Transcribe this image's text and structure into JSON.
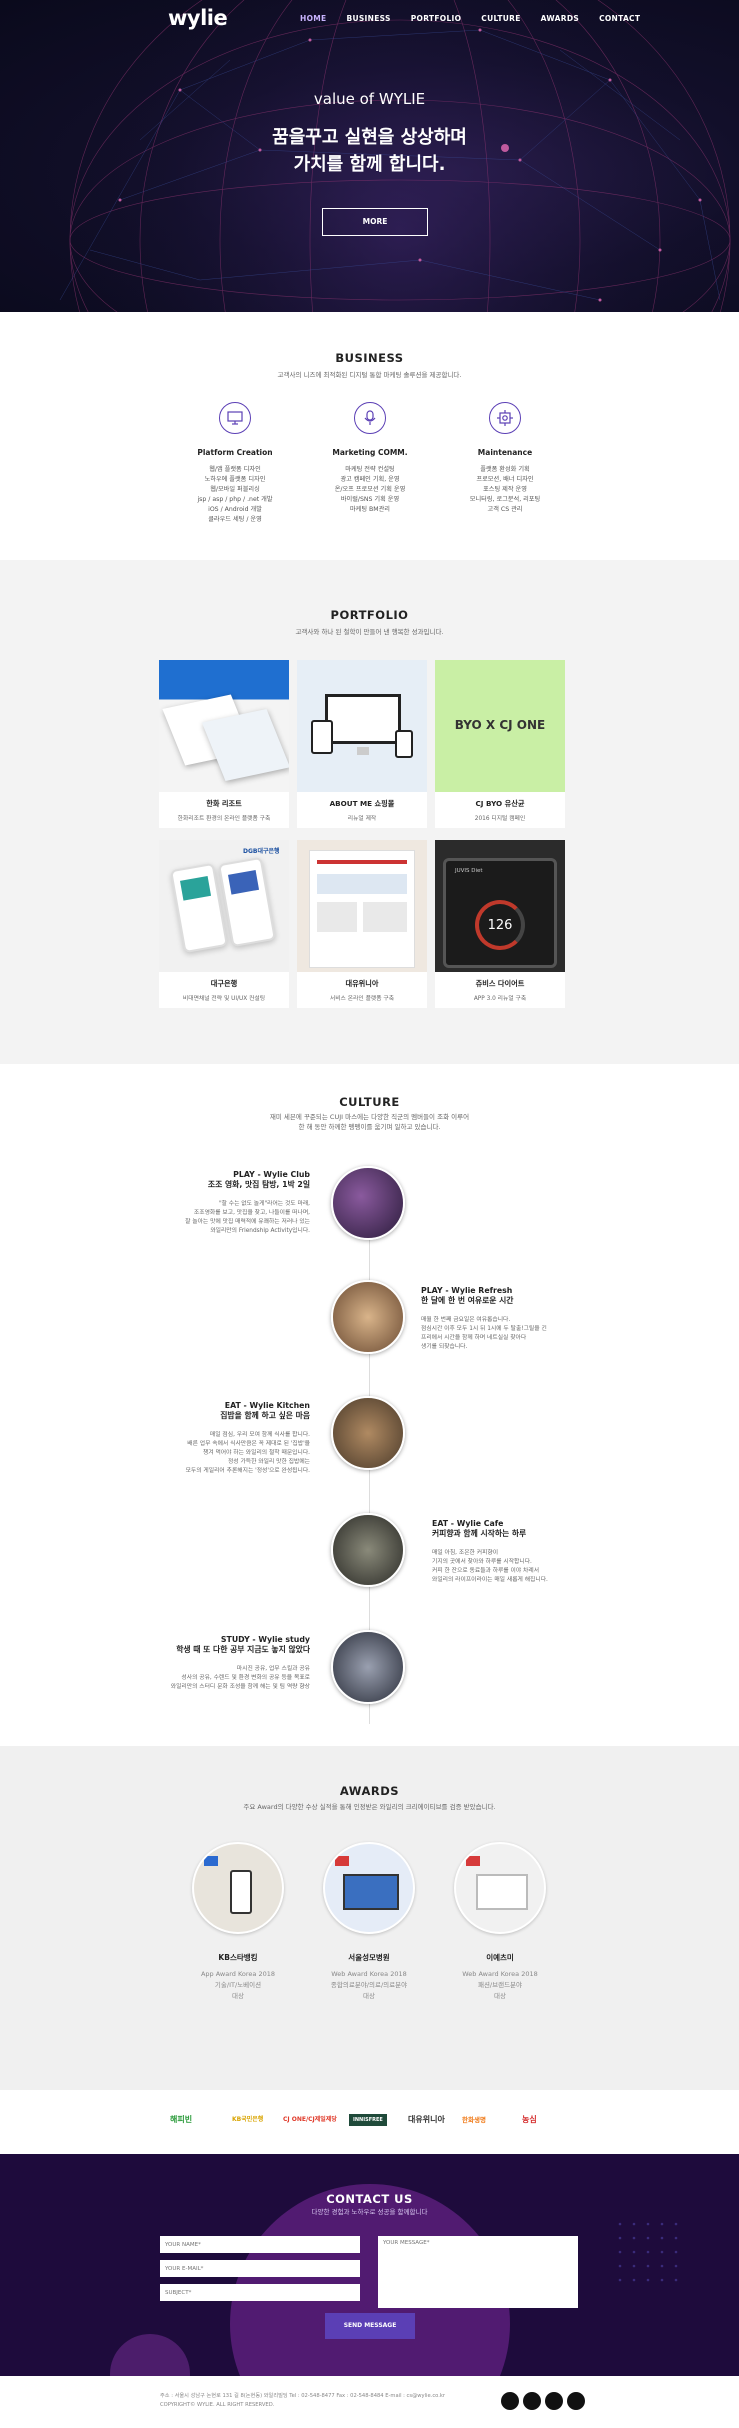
{
  "nav": {
    "logo": "wylie",
    "items": [
      "HOME",
      "BUSINESS",
      "PORTFOLIO",
      "CULTURE",
      "AWARDS",
      "CONTACT"
    ],
    "active": "HOME"
  },
  "hero": {
    "subtitle": "value of WYLIE",
    "title_line1": "꿈을꾸고 실현을 상상하며",
    "title_line2": "가치를 함께 합니다.",
    "button": "MORE"
  },
  "business": {
    "title": "BUSINESS",
    "desc": "고객사의 니즈에 최적화된 디지털 통합 마케팅 솔루션을 제공합니다.",
    "services": [
      {
        "icon": "monitor-icon",
        "title": "Platform Creation",
        "lines": [
          "웹/앱 플랫폼 디자인",
          "노하우에 플랫폼 디자인",
          "웹/모바일 퍼블리싱",
          "jsp / asp / php / .net 개발",
          "iOS / Android 개발",
          "클라우드 세팅 / 운영"
        ]
      },
      {
        "icon": "microphone-icon",
        "title": "Marketing COMM.",
        "lines": [
          "마케팅 전략 컨설팅",
          "광고 캠페인 기획, 운영",
          "온/오프 프로모션 기획 운영",
          "바이럴/SNS 기획 운영",
          "마케팅 BM관리"
        ]
      },
      {
        "icon": "maintenance-icon",
        "title": "Maintenance",
        "lines": [
          "플랫폼 환성화 기획",
          "프로모션, 배너 디자인",
          "포스팅 제작 운영",
          "모니터링, 로그분석, 리포팅",
          "고객 CS 관리"
        ]
      }
    ]
  },
  "portfolio": {
    "title": "PORTFOLIO",
    "desc": "고객사와 하나 된 철학이 만들어 낸 행복한 성과입니다.",
    "items": [
      {
        "title": "한화 리조트",
        "sub": "한화리조트 환경의 온라인 플랫폼 구축"
      },
      {
        "title": "ABOUT ME 쇼핑몰",
        "sub": "리뉴얼 제작"
      },
      {
        "title": "CJ BYO 유산균",
        "sub": "2016 디지털 캠페인",
        "logo": "BYO X CJ ONE"
      },
      {
        "title": "대구은행",
        "sub": "비대면채널 전략 및 UI/UX 컨설팅",
        "badge": "DGB대구은행"
      },
      {
        "title": "대유위니아",
        "sub": "서비스 온라인 플랫폼 구축"
      },
      {
        "title": "쥬비스 다이어트",
        "sub": "APP 3.0 리뉴얼 구축",
        "app": "JUVIS Diet",
        "metric": "126"
      }
    ]
  },
  "culture": {
    "title": "CULTURE",
    "desc_line1": "재미 세븐에 꾸준되는 CUJI 마스에는 다양한 직군의 멤버들이 조화 이루어",
    "desc_line2": "한 해 동안 하께한 펭펭이를 움기며 일하고 있습니다.",
    "items": [
      {
        "t1": "PLAY - Wylie Club",
        "t2": "조조 영화, 맛집 탐방, 1박 2일",
        "d": [
          "\"할 수는 없도 놀게\"라어는 것도 마래,",
          "조조영화를 보고, 맛집을 찾고, 나들이를 떠나며,",
          "잘 놀아는 맛에 맛집 매력적에 유쾌하는 저러나 있는",
          "와일리만의 Friendship Activity입니다."
        ]
      },
      {
        "t1": "PLAY - Wylie Refresh",
        "t2": "한 달에 한 번 여유로운 시간",
        "d": [
          "매월 한 번째 금요일은 여유롭습니다.",
          "점심시간 이후 모두 1시 뒤 1시에 두 탈출!그릴을 긴",
          "프리에서 시간을 함께 하며 네트실실 찾아다",
          "생기를 되찾습니다."
        ]
      },
      {
        "t1": "EAT - Wylie Kitchen",
        "t2": "집밥을 함께 하고 싶은 마음",
        "d": [
          "매일 점심, 우리 모여 함께 식사를 합니다.",
          "배른 업무 속에서 식사만큼은 꼭 제대로 된 '집밥'을",
          "챙겨 먹어야 하는 와일리의 철학 때문입니다.",
          "정성 가득한 와일리 맛한 집밥에는",
          "모두의 게일리어 추론해지는 '정성'으로 완성됩니다."
        ]
      },
      {
        "t1": "EAT - Wylie Cafe",
        "t2": "커피향과 함께 시작하는 하루",
        "d": [
          "매일 아침, 조은한 커피향이",
          "기지의 곳에서 찾아와 하루를 시작합니다.",
          "커피 한 잔으로 동료들과 하루를 이야 차례서",
          "와일리의 라이프이라이는 매일 새롭게 해집니다."
        ]
      },
      {
        "t1": "STUDY - Wylie study",
        "t2": "학생 때 또 다한 공부 지금도 놓지 않았다",
        "d": [
          "마시진 공유, 업무 스킬과 공유",
          "성사의 공유, 수렌드 및 환경 변화의 공유 등을 목표로",
          "와일리만의 스터디 문화 조성을 함께 해는 및 팀 역량 향상"
        ]
      }
    ]
  },
  "awards": {
    "title": "AWARDS",
    "desc": "주요 Award의 다양한 수상 실적을 통해 인정받은 와일리의 크리에이티브를 검증 받았습니다.",
    "items": [
      {
        "title": "KB스타뱅킹",
        "lines": [
          "App Award Korea 2018",
          "기술/IT/노베이션",
          "대상"
        ]
      },
      {
        "title": "서울성모병원",
        "lines": [
          "Web Award Korea 2018",
          "종합의료분야/의료/의료분야",
          "대상"
        ]
      },
      {
        "title": "이예츠미",
        "lines": [
          "Web Award Korea 2018",
          "패션/브랜드분야",
          "대상"
        ]
      }
    ]
  },
  "partners": [
    "해피빈",
    "KB국민은행",
    "CJ ONE/CJ제일제당",
    "INNISFREE",
    "대유위니아",
    "한화생명",
    "농심"
  ],
  "contact": {
    "title": "CONTACT US",
    "desc": "다양한 경험과 노하우로 성공을 함께합니다",
    "name_ph": "YOUR NAME*",
    "email_ph": "YOUR E-MAIL*",
    "subject_ph": "SUBJECT*",
    "message_ph": "YOUR MESSAGE*",
    "send": "SEND MESSAGE"
  },
  "footer": {
    "line1": "주소 : 서울시 성남구 논현로 131 길 8(논현동) 와일리빌딩 Tel : 02-548-8477 Fax : 02-548-8484 E-mail : cs@wylie.co.kr",
    "line2": "COPYRIGHT© WYLIE. ALL RIGHT RESERVED."
  }
}
